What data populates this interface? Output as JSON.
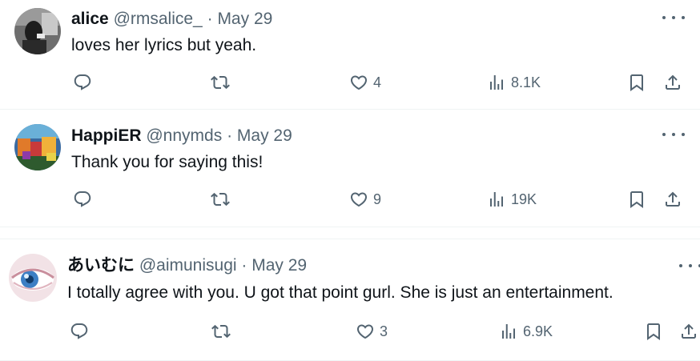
{
  "tweets": [
    {
      "name": "alice",
      "handle": "@rmsalice_",
      "dot": "·",
      "date": "May 29",
      "text": "loves her lyrics but yeah.",
      "likes": "4",
      "views": "8.1K"
    },
    {
      "name": "HappiER",
      "handle": "@nnymds",
      "dot": "·",
      "date": "May 29",
      "text": "Thank you for saying this!",
      "likes": "9",
      "views": "19K"
    },
    {
      "name": "あいむに",
      "handle": "@aimunisugi",
      "dot": "·",
      "date": "May 29",
      "text": "I totally agree with you. U got that point gurl. She is just an entertainment.",
      "likes": "3",
      "views": "6.9K"
    }
  ],
  "icons": {
    "reply": "reply-icon",
    "retweet": "retweet-icon",
    "like": "heart-icon",
    "views": "views-icon",
    "bookmark": "bookmark-icon",
    "share": "share-icon",
    "more": "more-icon"
  },
  "colors": {
    "text": "#0f1419",
    "secondary": "#536471",
    "divider": "#eff3f4"
  }
}
